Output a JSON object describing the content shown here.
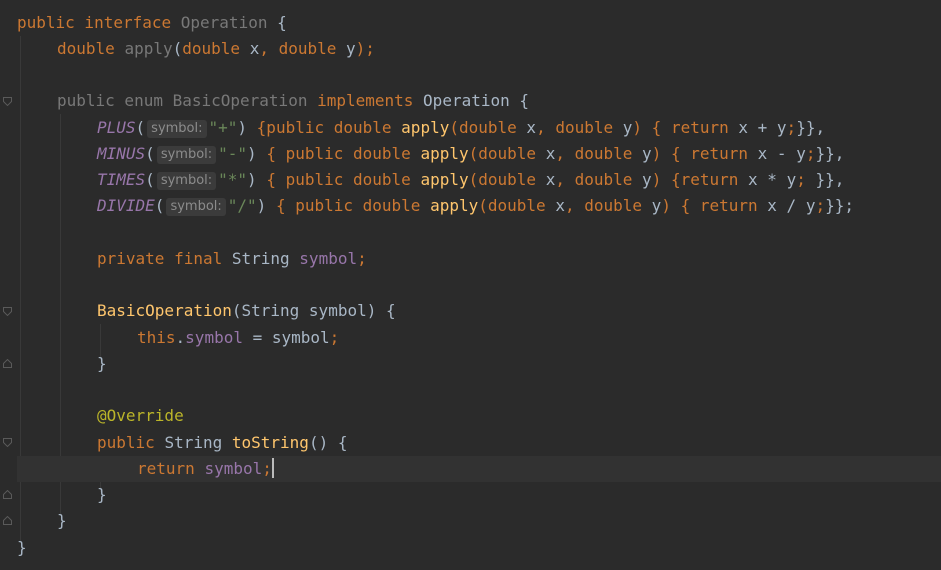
{
  "editor": {
    "language": "java",
    "colors": {
      "background": "#2b2b2b",
      "keyword": "#cc7832",
      "method": "#ffc66d",
      "field": "#9876aa",
      "string": "#6a8759",
      "annotation": "#bbb529",
      "text": "#a9b7c6"
    },
    "hint_label": "symbol:",
    "lines": {
      "l1": {
        "t1": "public interface ",
        "t2": "Operation",
        "t3": " {"
      },
      "l2": {
        "t1": "double ",
        "t2": "apply",
        "t3": "(",
        "t4": "double ",
        "t5": "x",
        "t6": ", ",
        "t7": "double ",
        "t8": "y",
        "t9": ");"
      },
      "l4": {
        "t1": "public enum ",
        "t2": "BasicOperation",
        "t3": " implements ",
        "t4": "Operation",
        "t5": " {"
      },
      "l5": {
        "c": "PLUS",
        "s": "\"+\"",
        "body_kw": "{public double ",
        "m": "apply",
        "p1": "(",
        "d1": "double ",
        "x": "x",
        "cm": ", ",
        "d2": "double ",
        "y": "y",
        "rp": ") { ",
        "ret": "return ",
        "expr": "x + y",
        "semi": ";",
        "end": "}},"
      },
      "l6": {
        "c": "MINUS",
        "s": "\"-\"",
        "body_kw": " { public double ",
        "m": "apply",
        "p1": "(",
        "d1": "double ",
        "x": "x",
        "cm": ", ",
        "d2": "double ",
        "y": "y",
        "rp": ") { ",
        "ret": "return ",
        "expr": "x - y",
        "semi": ";",
        "end": "}},"
      },
      "l7": {
        "c": "TIMES",
        "s": "\"*\"",
        "body_kw": " { public double ",
        "m": "apply",
        "p1": "(",
        "d1": "double ",
        "x": "x",
        "cm": ", ",
        "d2": "double ",
        "y": "y",
        "rp": ") {",
        "ret": "return ",
        "expr": "x * y",
        "semi": "; ",
        "end": "}},"
      },
      "l8": {
        "c": "DIVIDE",
        "s": "\"/\"",
        "body_kw": " { public double ",
        "m": "apply",
        "p1": "(",
        "d1": "double ",
        "x": "x",
        "cm": ", ",
        "d2": "double ",
        "y": "y",
        "rp": ") { ",
        "ret": "return ",
        "expr": "x / y",
        "semi": ";",
        "end": "}};"
      },
      "l10": {
        "t1": "private final ",
        "t2": "String ",
        "t3": "symbol",
        "t4": ";"
      },
      "l12": {
        "t1": "BasicOperation",
        "t2": "(String symbol) {"
      },
      "l13": {
        "t1": "this",
        "t2": ".",
        "t3": "symbol",
        "t4": " = symbol",
        "t5": ";"
      },
      "l14": {
        "t1": "}"
      },
      "l16": {
        "t1": "@Override"
      },
      "l17": {
        "t1": "public ",
        "t2": "String ",
        "t3": "toString",
        "t4": "() {"
      },
      "l18": {
        "t1": "return ",
        "t2": "symbol",
        "t3": ";"
      },
      "l19": {
        "t1": "}"
      },
      "l20": {
        "t1": "}"
      },
      "l21": {
        "t1": "}"
      }
    }
  }
}
